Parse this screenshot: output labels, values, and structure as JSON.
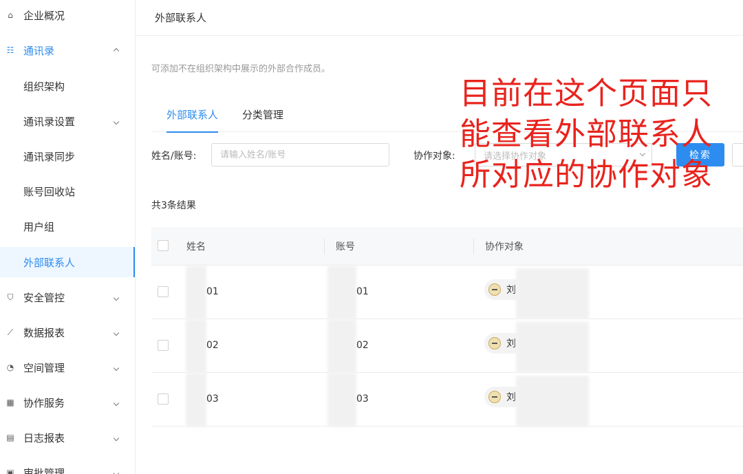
{
  "sidebar": {
    "items": [
      {
        "label": "企业概况",
        "icon": "home-icon"
      },
      {
        "label": "通讯录",
        "icon": "contacts-icon"
      },
      {
        "label": "组织架构"
      },
      {
        "label": "通讯录设置"
      },
      {
        "label": "通讯录同步"
      },
      {
        "label": "账号回收站"
      },
      {
        "label": "用户组"
      },
      {
        "label": "外部联系人"
      },
      {
        "label": "安全管控",
        "icon": "shield-icon"
      },
      {
        "label": "数据报表",
        "icon": "chart-icon"
      },
      {
        "label": "空间管理",
        "icon": "pie-icon"
      },
      {
        "label": "协作服务",
        "icon": "grid-icon"
      },
      {
        "label": "日志报表",
        "icon": "document-icon"
      },
      {
        "label": "审批管理",
        "icon": "approval-icon"
      }
    ]
  },
  "header": {
    "title": "外部联系人"
  },
  "main": {
    "description": "可添加不在组织架构中展示的外部合作成员。",
    "tabs": [
      {
        "label": "外部联系人"
      },
      {
        "label": "分类管理"
      }
    ],
    "filters": {
      "name_label": "姓名/账号:",
      "name_placeholder": "请输入姓名/账号",
      "partner_label": "协作对象:",
      "partner_placeholder": "请选择协作对象",
      "search_label": "检索"
    },
    "result_count": "共3条结果",
    "table": {
      "columns": [
        "姓名",
        "账号",
        "协作对象"
      ],
      "rows": [
        {
          "name": "01",
          "account": "01",
          "partner": "刘"
        },
        {
          "name": "02",
          "account": "02",
          "partner": "刘"
        },
        {
          "name": "03",
          "account": "03",
          "partner": "刘"
        }
      ]
    }
  },
  "annotation": {
    "line1": "目前在这个页面只",
    "line2": "能查看外部联系人",
    "line3": "所对应的协作对象"
  },
  "colors": {
    "accent": "#2d8cf0",
    "annotation": "#e8231d"
  }
}
